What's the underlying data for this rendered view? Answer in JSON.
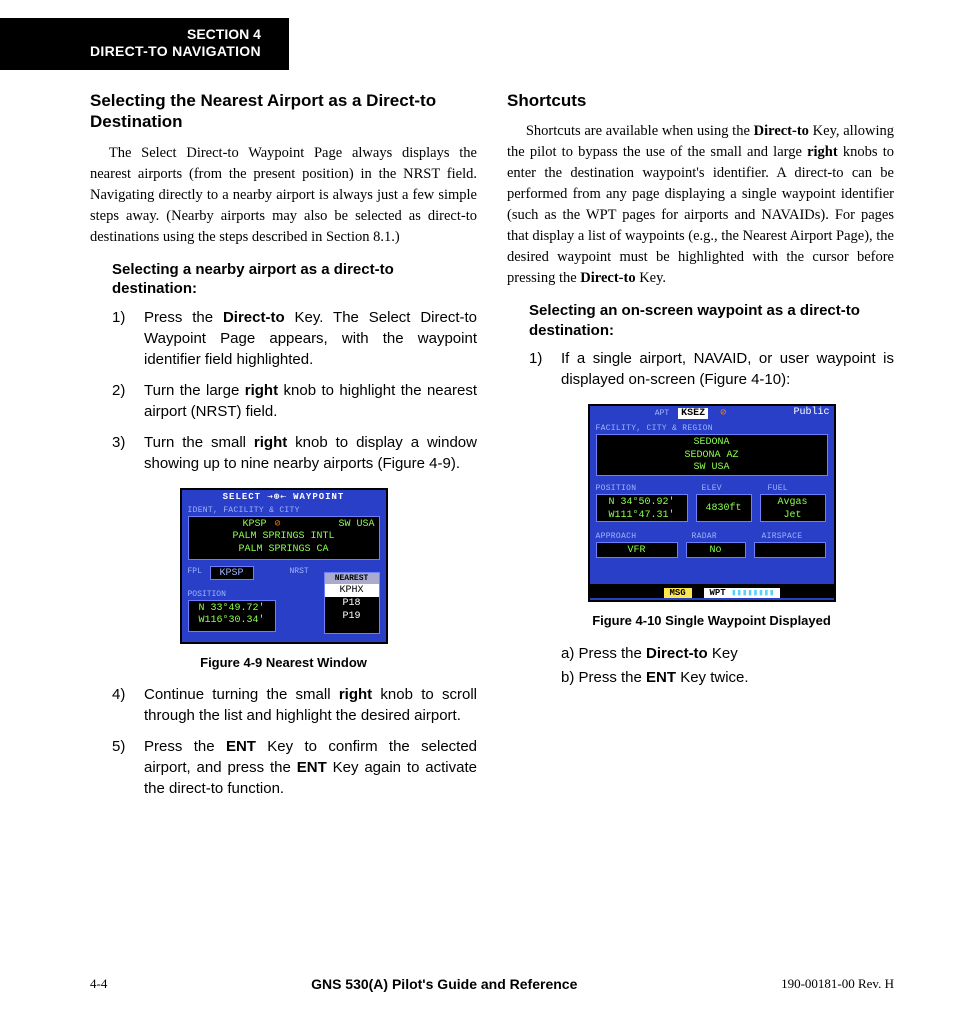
{
  "section_tab": {
    "line1": "SECTION 4",
    "line2": "DIRECT-TO NAVIGATION"
  },
  "left": {
    "heading": "Selecting the Nearest Airport as a Direct-to Destination",
    "intro": "The Select Direct-to Waypoint Page always displays the nearest airports (from the present position) in the NRST field.  Navigating directly to a nearby airport is always just a few simple steps away.  (Nearby airports may also be selected as direct-to destinations using the steps described in Section 8.1.)",
    "subheading": "Selecting a nearby airport as a direct-to destination:",
    "steps_a": [
      {
        "num": "1)",
        "pre": "Press the ",
        "b": "Direct-to",
        "post": " Key.  The Select Direct-to Waypoint Page appears, with the waypoint identifier field highlighted."
      },
      {
        "num": "2)",
        "pre": "Turn the large ",
        "b": "right",
        "post": " knob to highlight the nearest airport (NRST) field."
      },
      {
        "num": "3)",
        "pre": "Turn the small ",
        "b": "right",
        "post": " knob to display a window showing up to nine nearby airports (Figure 4-9)."
      }
    ],
    "steps_b": [
      {
        "num": "4)",
        "pre": "Continue turning the small ",
        "b": "right",
        "post": " knob to scroll through the list and highlight the desired airport."
      },
      {
        "num": "5)",
        "pre": "Press the ",
        "b": "ENT",
        "mid": " Key to confirm the selected airport, and press the ",
        "b2": "ENT",
        "post2": " Key again to activate the direct-to function."
      }
    ],
    "fig_caption": "Figure 4-9  Nearest Window",
    "screen1": {
      "title": "SELECT ⇢⊕⇠ WAYPOINT",
      "label1": "IDENT, FACILITY & CITY",
      "line1": "KPSP",
      "line1b": "SW USA",
      "line2": "PALM SPRINGS INTL",
      "line3": "PALM SPRINGS CA",
      "fpl_label": "FPL",
      "fpl_val": "KPSP",
      "nrst_label": "NRST",
      "pos_label": "POSITION",
      "lat": "N 33°49.72'",
      "lon": "W116°30.34'",
      "nearest_title": "NEAREST",
      "nearest_items": [
        "KPHX",
        "P18",
        "P19"
      ]
    }
  },
  "right": {
    "heading": "Shortcuts",
    "intro_parts": {
      "p1": "Shortcuts are available when using the ",
      "b1": "Direct-to",
      "p2": " Key, allowing the pilot to bypass the use of the small and large ",
      "b2": "right",
      "p3": " knobs to enter the destination waypoint's identifier.  A direct-to can be performed from any page displaying a single waypoint identifier (such as the WPT pages for airports and NAVAIDs).  For pages that display a list of waypoints (e.g., the Nearest Airport Page), the desired waypoint must be highlighted with the cursor before pressing the ",
      "b3": "Direct-to",
      "p4": " Key."
    },
    "subheading": "Selecting an on-screen waypoint as a direct-to destination:",
    "steps": [
      {
        "num": "1)",
        "txt": "If a single airport, NAVAID, or user waypoint is displayed on-screen (Figure 4-10):"
      }
    ],
    "fig_caption": "Figure 4-10  Single Waypoint Displayed",
    "sub_a_pre": "a)  Press the ",
    "sub_a_b": "Direct-to",
    "sub_a_post": " Key",
    "sub_b_pre": "b)  Press the ",
    "sub_b_b": "ENT",
    "sub_b_post": " Key twice.",
    "screen2": {
      "apt_label": "APT",
      "ident": "KSEZ",
      "type": "Public",
      "sec1": "FACILITY, CITY & REGION",
      "fac_l1": "SEDONA",
      "fac_l2": "SEDONA AZ",
      "fac_l3": "SW USA",
      "pos_lbl": "POSITION",
      "elev_lbl": "ELEV",
      "fuel_lbl": "FUEL",
      "lat": "N 34°50.92'",
      "lon": "W111°47.31'",
      "elev": "4830ft",
      "fuel1": "Avgas",
      "fuel2": "Jet",
      "app_lbl": "APPROACH",
      "radar_lbl": "RADAR",
      "air_lbl": "AIRSPACE",
      "app_val": "VFR",
      "radar_val": "No",
      "air_val": "",
      "msg": "MSG",
      "wpt": "WPT"
    }
  },
  "footer": {
    "left": "4-4",
    "center": "GNS 530(A) Pilot's Guide and Reference",
    "right": "190-00181-00  Rev. H"
  }
}
